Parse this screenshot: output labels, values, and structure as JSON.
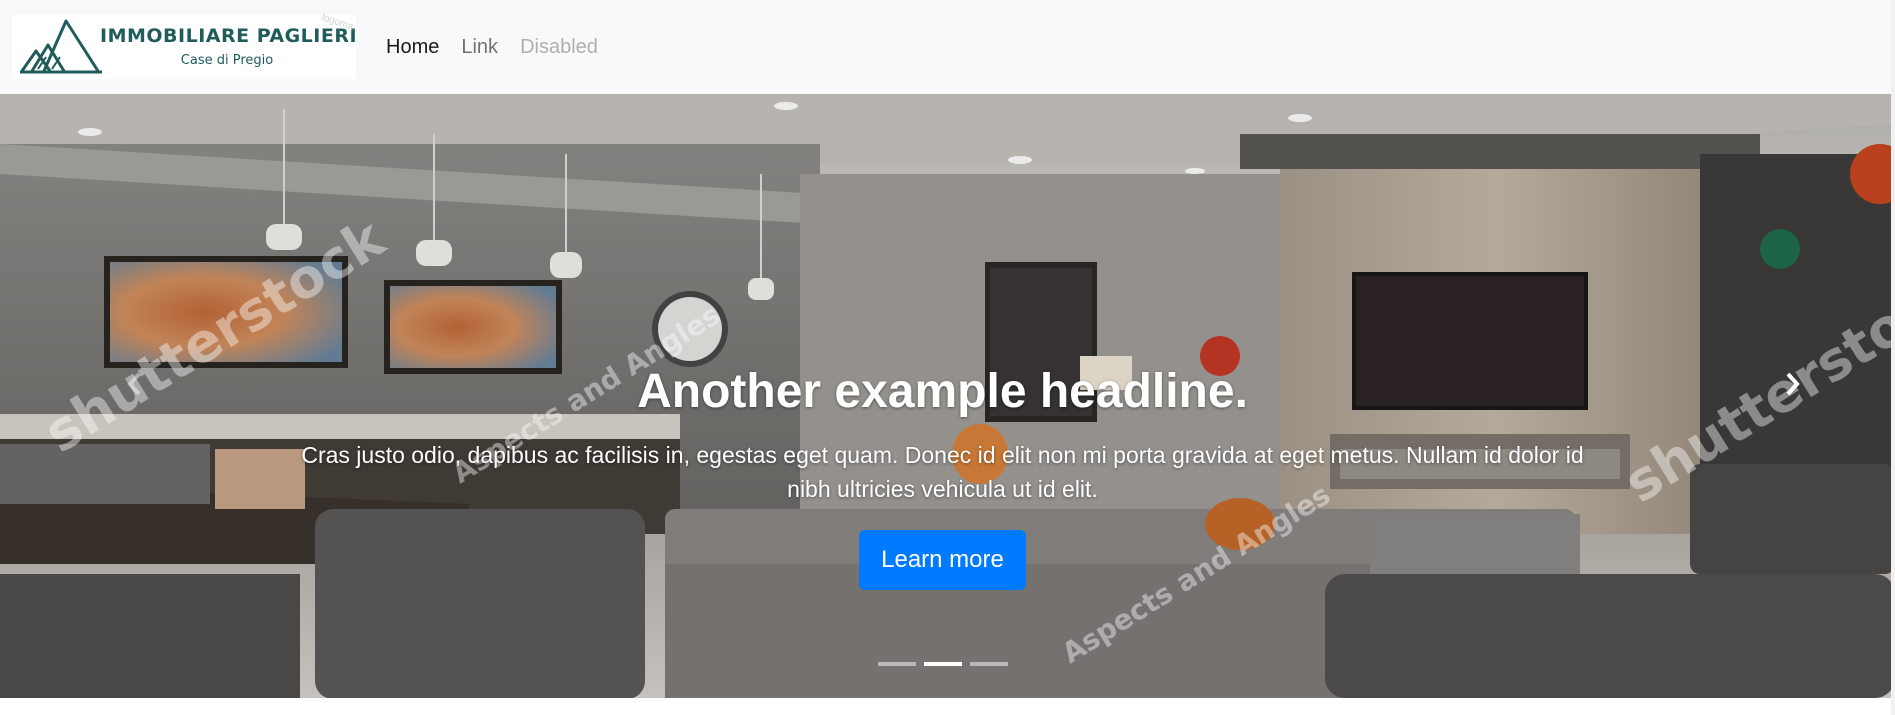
{
  "brand": {
    "name": "IMMOBILIARE PAGLIERI",
    "tagline": "Case di Pregio",
    "watermark": "logoma",
    "color": "#1f5c5a"
  },
  "nav": {
    "items": [
      {
        "label": "Home",
        "state": "active"
      },
      {
        "label": "Link",
        "state": "normal"
      },
      {
        "label": "Disabled",
        "state": "disabled"
      }
    ]
  },
  "carousel": {
    "headline": "Another example headline.",
    "text": "Cras justo odio, dapibus ac facilisis in, egestas eget quam. Donec id elit non mi porta gravida at eget metus. Nullam id dolor id nibh ultricies vehicula ut id elit.",
    "button_label": "Learn more",
    "button_color": "#007bff",
    "prev_icon": "chevron-left-icon",
    "next_icon": "chevron-right-icon",
    "indicators": 3,
    "active_indicator": 2,
    "image_watermarks": [
      "shutterstock",
      "Aspects and Angles"
    ]
  }
}
